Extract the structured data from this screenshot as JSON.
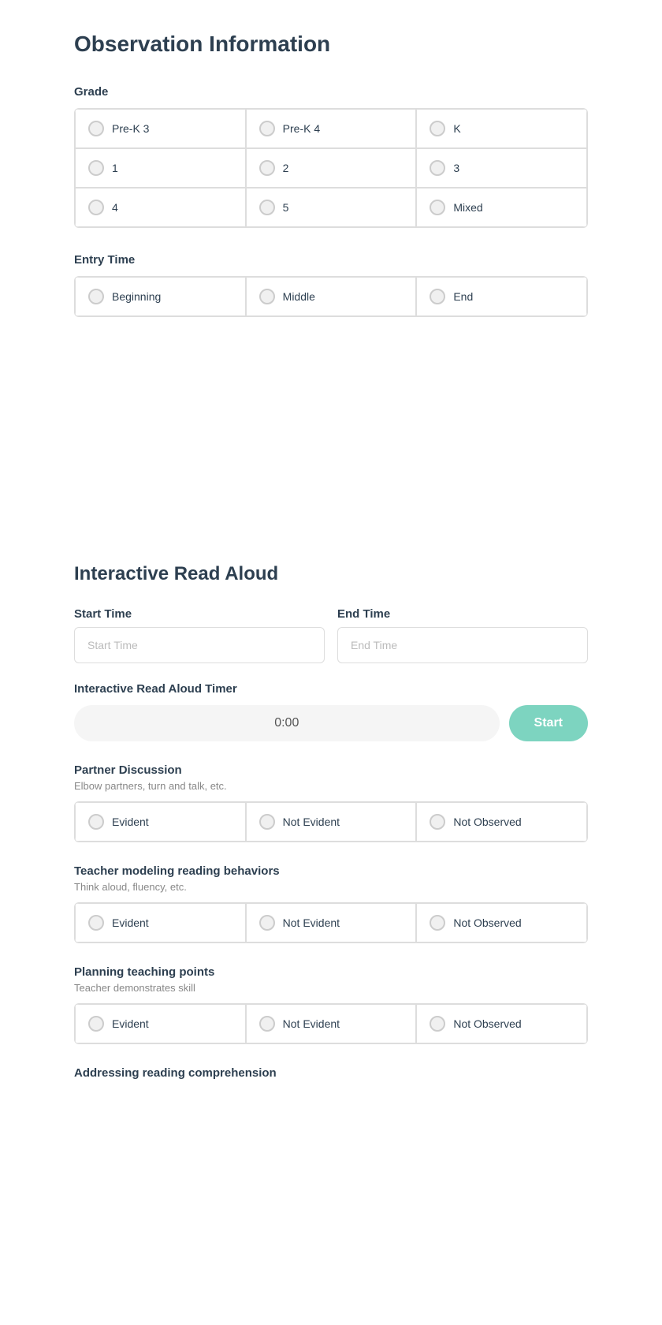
{
  "page": {
    "section1_title": "Observation Information",
    "section2_title": "Interactive Read Aloud",
    "grade_label": "Grade",
    "grade_options": [
      "Pre-K 3",
      "Pre-K 4",
      "K",
      "1",
      "2",
      "3",
      "4",
      "5",
      "Mixed"
    ],
    "entry_time_label": "Entry Time",
    "entry_time_options": [
      "Beginning",
      "Middle",
      "End"
    ],
    "start_time_label": "Start Time",
    "start_time_placeholder": "Start Time",
    "end_time_label": "End Time",
    "end_time_placeholder": "End Time",
    "timer_label": "Interactive Read Aloud Timer",
    "timer_value": "0:00",
    "timer_start_btn": "Start",
    "partner_discussion_label": "Partner Discussion",
    "partner_discussion_sublabel": "Elbow partners, turn and talk, etc.",
    "partner_discussion_options": [
      "Evident",
      "Not Evident",
      "Not Observed"
    ],
    "teacher_modeling_label": "Teacher modeling reading behaviors",
    "teacher_modeling_sublabel": "Think aloud, fluency, etc.",
    "teacher_modeling_options": [
      "Evident",
      "Not Evident",
      "Not Observed"
    ],
    "planning_teaching_label": "Planning teaching points",
    "planning_teaching_sublabel": "Teacher demonstrates skill",
    "planning_teaching_options": [
      "Evident",
      "Not Evident",
      "Not Observed"
    ],
    "addressing_label": "Addressing reading comprehension"
  }
}
